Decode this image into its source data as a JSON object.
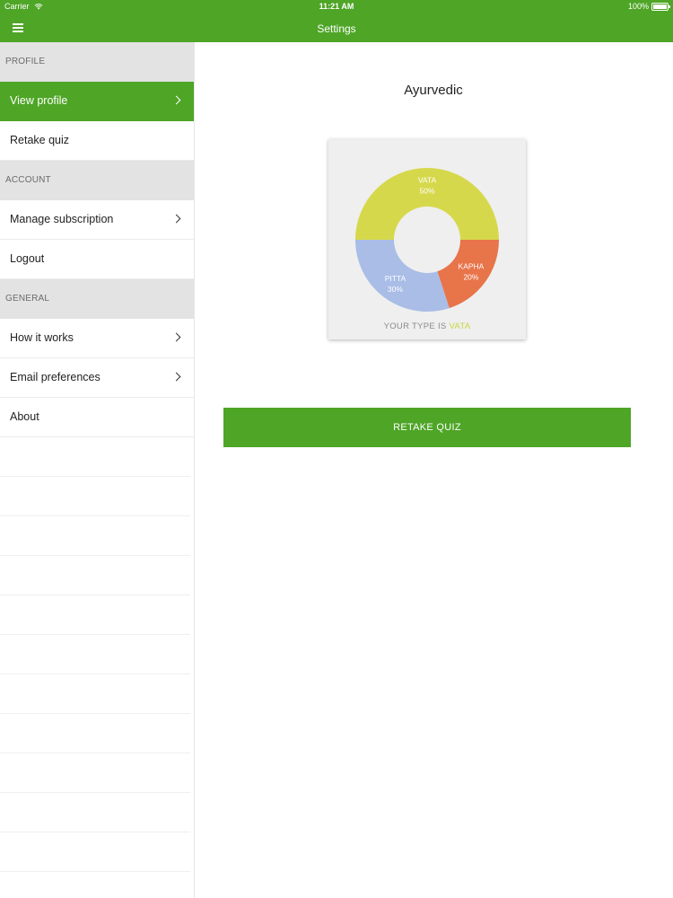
{
  "status_bar": {
    "carrier": "Carrier",
    "time": "11:21 AM",
    "battery": "100%"
  },
  "nav": {
    "title": "Settings",
    "menu_icon": "hamburger-icon"
  },
  "sidebar": {
    "sections": [
      {
        "header": "PROFILE",
        "items": [
          {
            "label": "View profile",
            "chevron": true,
            "active": true
          },
          {
            "label": "Retake quiz",
            "chevron": false,
            "active": false
          }
        ]
      },
      {
        "header": "ACCOUNT",
        "items": [
          {
            "label": "Manage subscription",
            "chevron": true,
            "active": false
          },
          {
            "label": "Logout",
            "chevron": false,
            "active": false
          }
        ]
      },
      {
        "header": "GENERAL",
        "items": [
          {
            "label": "How it works",
            "chevron": true,
            "active": false
          },
          {
            "label": "Email preferences",
            "chevron": true,
            "active": false
          },
          {
            "label": "About",
            "chevron": false,
            "active": false
          }
        ]
      }
    ]
  },
  "main": {
    "title": "Ayurvedic",
    "result_prefix": "YOUR TYPE IS",
    "result_type": "VATA",
    "retake_button": "RETAKE QUIZ"
  },
  "colors": {
    "accent": "#4ea526",
    "vata": "#d6d84c",
    "pitta": "#a9bde6",
    "kapha": "#e8744a"
  },
  "chart_data": {
    "type": "pie",
    "categories": [
      "VATA",
      "KAPHA",
      "PITTA"
    ],
    "values": [
      50,
      20,
      30
    ],
    "labels": [
      "50%",
      "20%",
      "30%"
    ],
    "colors": [
      "#d6d84c",
      "#e8744a",
      "#a9bde6"
    ]
  }
}
